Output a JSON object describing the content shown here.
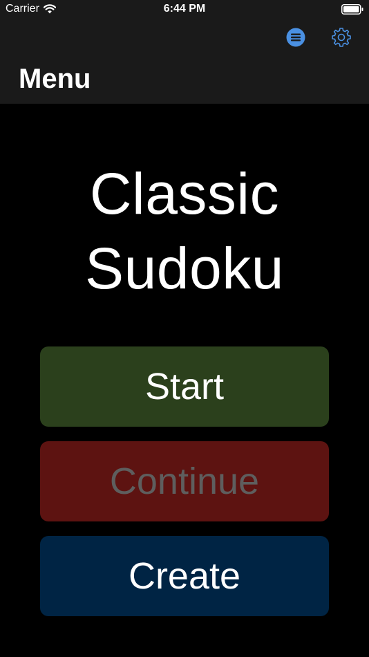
{
  "status_bar": {
    "carrier": "Carrier",
    "time": "6:44 PM",
    "wifi_icon": "wifi-icon",
    "battery_icon": "battery-icon"
  },
  "nav": {
    "title": "Menu",
    "list_icon": "list-icon",
    "settings_icon": "gear-icon",
    "accent_color": "#4a90e2"
  },
  "main": {
    "title_line1": "Classic",
    "title_line2": "Sudoku"
  },
  "buttons": {
    "start": {
      "label": "Start",
      "color": "#2b401c"
    },
    "continue": {
      "label": "Continue",
      "color": "#5d1311",
      "state": "disabled"
    },
    "create": {
      "label": "Create",
      "color": "#002444"
    }
  }
}
